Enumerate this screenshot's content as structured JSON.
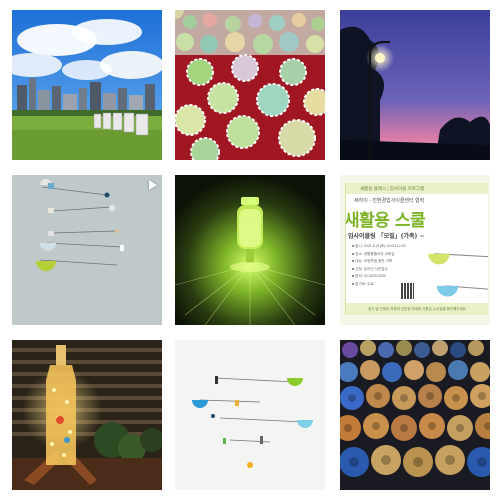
{
  "grid": {
    "tiles": [
      {
        "subject": "city-skyline-park",
        "alt": "City skyline with signboards in a park"
      },
      {
        "subject": "gear-shaped-bottle-caps",
        "alt": "Colorful gear-shaped pieces on red surface"
      },
      {
        "subject": "street-lamp-sunset",
        "alt": "Street lamp against twilight sky"
      },
      {
        "subject": "hanging-mobile",
        "alt": "Minimal hanging mobile on gray background",
        "has_video": true
      },
      {
        "subject": "green-glow-bottle",
        "alt": "Glowing green glass bottle in the dark"
      },
      {
        "subject": "eco-class-poster",
        "alt": "Green event poster"
      },
      {
        "subject": "bottle-lamp",
        "alt": "Bottle lamp with lights by window blinds"
      },
      {
        "subject": "mobile-white",
        "alt": "Colorful hanging mobile on white background"
      },
      {
        "subject": "coffee-capsules",
        "alt": "Rows of coffee capsules"
      }
    ]
  },
  "poster": {
    "header": "새활용 클래스 | 업사이클 프로그램",
    "org": "새하이 · 친환경업사이클센터 협력",
    "title": "새활용 스쿨",
    "subtitle": "업사이클링 「모빌」(가족) ~",
    "lines": [
      "■ 일시: 2021.8.21(토) 10:00-12:00",
      "■ 장소: 새활용플라자 교육실",
      "■ 대상: 초등학생 동반 가족",
      "■ 신청: 온라인 사전접수",
      "■ 문의: 02-0000-0000",
      "■ 참가비: 무료"
    ],
    "footer": "참가 및 신청자 지원과 관련된 자세한 사항은 누리집을 확인해주세요"
  },
  "colors": {
    "poster_accent": "#7bb325",
    "poster_bg": "#f4f7e7"
  }
}
